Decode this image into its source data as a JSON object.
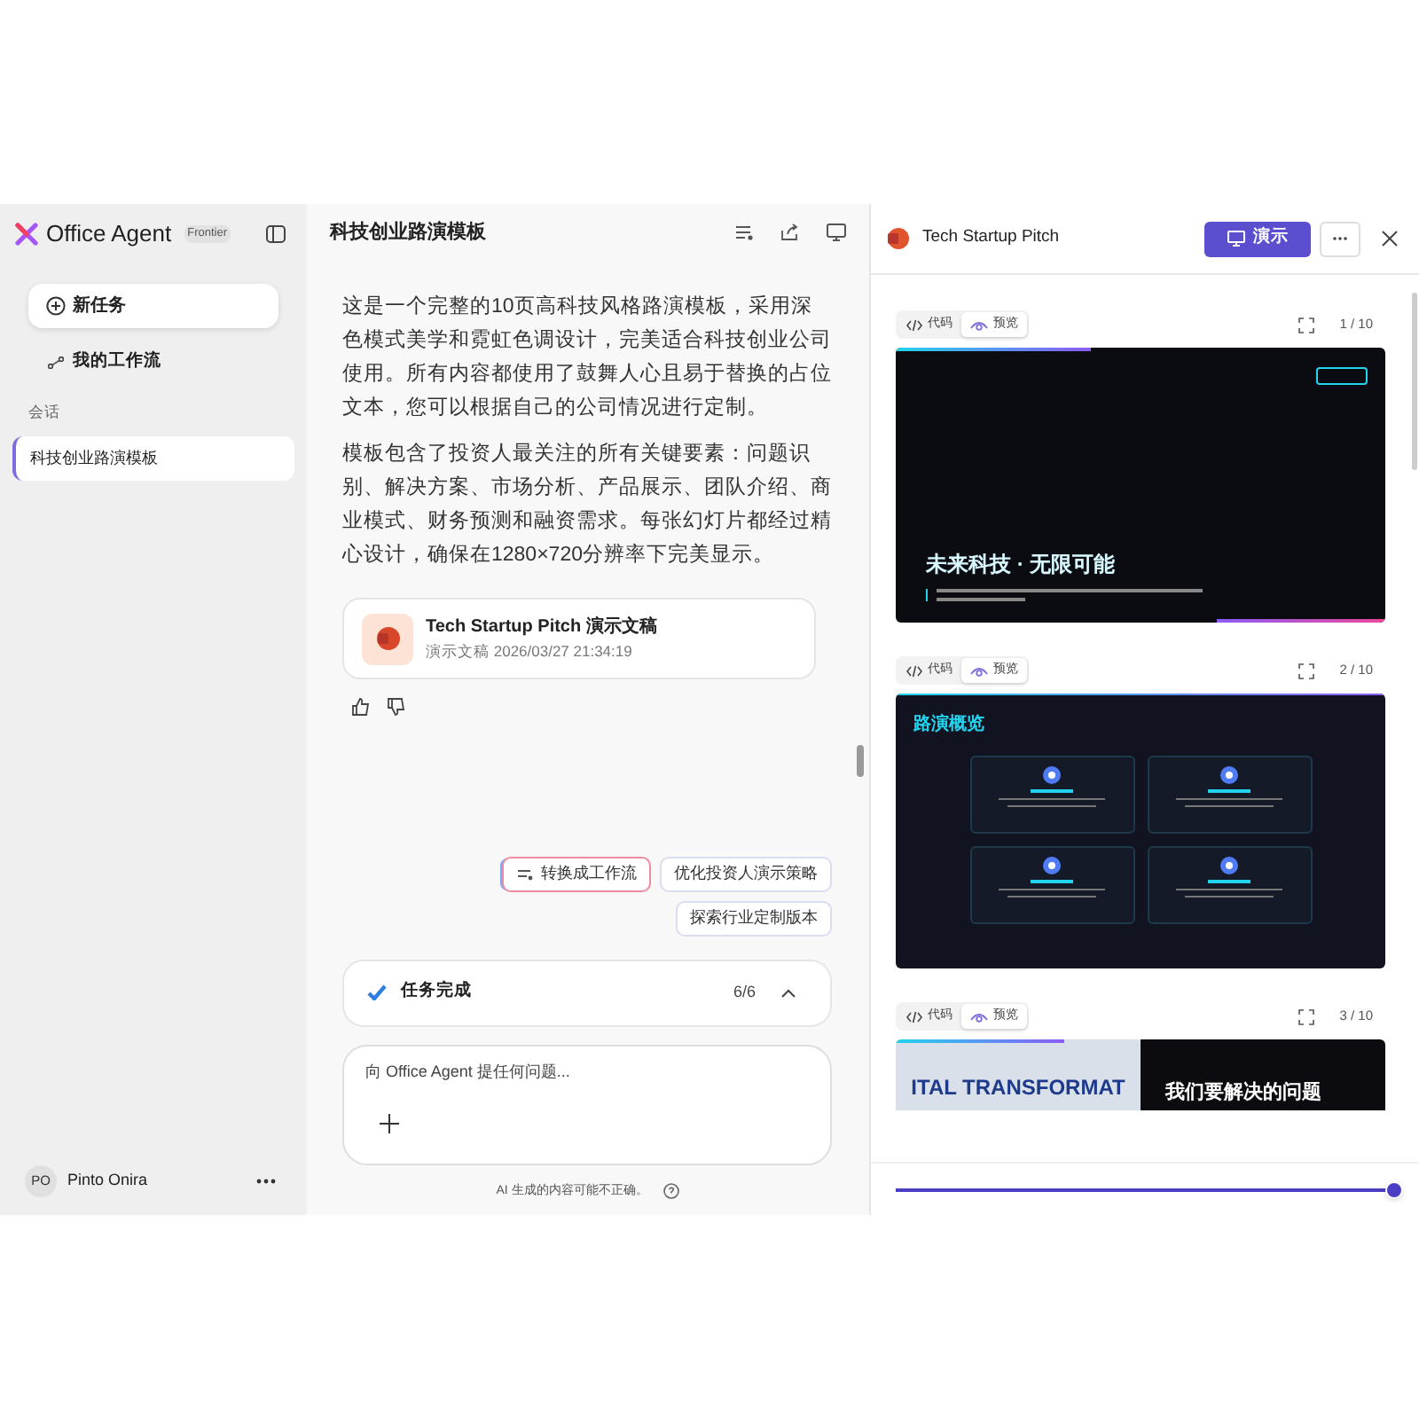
{
  "sidebar": {
    "app_name": "Office Agent",
    "badge": "Frontier",
    "nav": [
      {
        "label": "新任务",
        "kind": "new"
      },
      {
        "label": "我的工作流",
        "kind": "workflow"
      }
    ],
    "section": "会话",
    "sessions": [
      {
        "label": "科技创业路演模板",
        "selected": true
      }
    ],
    "user": {
      "initials": "PO",
      "name": "Pinto Onira"
    }
  },
  "chat": {
    "title": "科技创业路演模板",
    "paragraphs": [
      "这是一个完整的10页高科技风格路演模板，采用深色模式美学和霓虹色调设计，完美适合科技创业公司使用。所有内容都使用了鼓舞人心且易于替换的占位文本，您可以根据自己的公司情况进行定制。",
      "模板包含了投资人最关注的所有关键要素：问题识别、解决方案、市场分析、产品展示、团队介绍、商业模式、财务预测和融资需求。每张幻灯片都经过精心设计，确保在1280×720分辨率下完美显示。"
    ],
    "file": {
      "title": "Tech Startup Pitch 演示文稿",
      "subtitle": "演示文稿 2026/03/27 21:34:19"
    },
    "suggestions": [
      {
        "label": "转换成工作流",
        "kind": "workflow"
      },
      {
        "label": "优化投资人演示策略",
        "kind": "plain"
      },
      {
        "label": "探索行业定制版本",
        "kind": "plain"
      }
    ],
    "task": {
      "label": "任务完成",
      "count": "6/6",
      "expanded": true
    },
    "input": {
      "placeholder": "向 Office Agent 提任何问题..."
    },
    "disclaimer": "AI 生成的内容可能不正确。"
  },
  "preview": {
    "title": "Tech Startup Pitch",
    "present_button": "演示",
    "slides": [
      {
        "kind": "title",
        "page": "1 / 10",
        "views": [
          {
            "label": "代码",
            "selected": false
          },
          {
            "label": "预览",
            "selected": true
          }
        ],
        "heading": "未来科技 · 无限可能"
      },
      {
        "kind": "overview",
        "page": "2 / 10",
        "views": [
          {
            "label": "代码",
            "selected": false
          },
          {
            "label": "预览",
            "selected": true
          }
        ],
        "heading": "路演概览"
      },
      {
        "kind": "split",
        "page": "3 / 10",
        "views": [
          {
            "label": "代码",
            "selected": false
          },
          {
            "label": "预览",
            "selected": true
          }
        ],
        "left_text": "ITAL TRANSFORMAT",
        "heading": "我们要解决的问题"
      }
    ],
    "zoom": {
      "level": 1
    }
  }
}
